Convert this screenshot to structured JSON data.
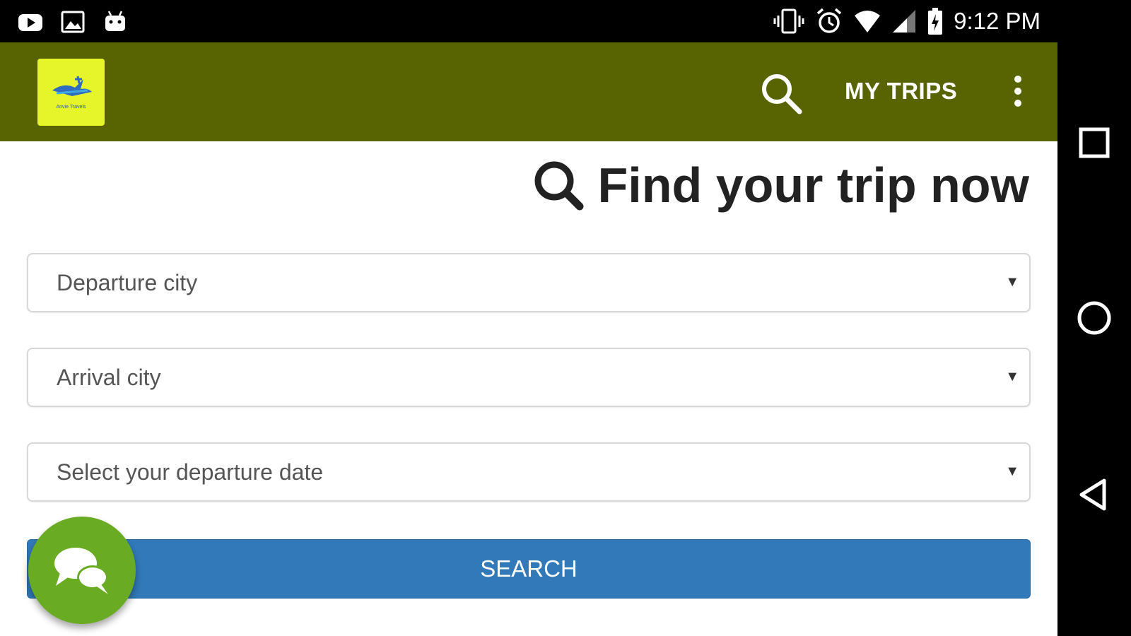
{
  "status_bar": {
    "time": "9:12 PM",
    "left_icons": [
      "youtube-icon",
      "image-icon",
      "android-icon"
    ],
    "right_icons": [
      "vibrate-icon",
      "alarm-icon",
      "wifi-icon",
      "signal-icon",
      "battery-icon"
    ]
  },
  "app_bar": {
    "background": "#586402",
    "logo_text": "Anvie Travels",
    "my_trips_label": "MY TRIPS",
    "search_icon": "search-icon",
    "more_icon": "more-vert-icon"
  },
  "main": {
    "heading": "Find your trip now",
    "fields": [
      {
        "label": "Departure city"
      },
      {
        "label": "Arrival city"
      },
      {
        "label": "Select your departure date"
      }
    ],
    "search_button_label": "SEARCH",
    "search_button_color": "#3179b8",
    "chat_button_color": "#6aab24"
  },
  "nav_bar": {
    "buttons": [
      "recents-icon",
      "home-icon",
      "back-icon"
    ]
  }
}
